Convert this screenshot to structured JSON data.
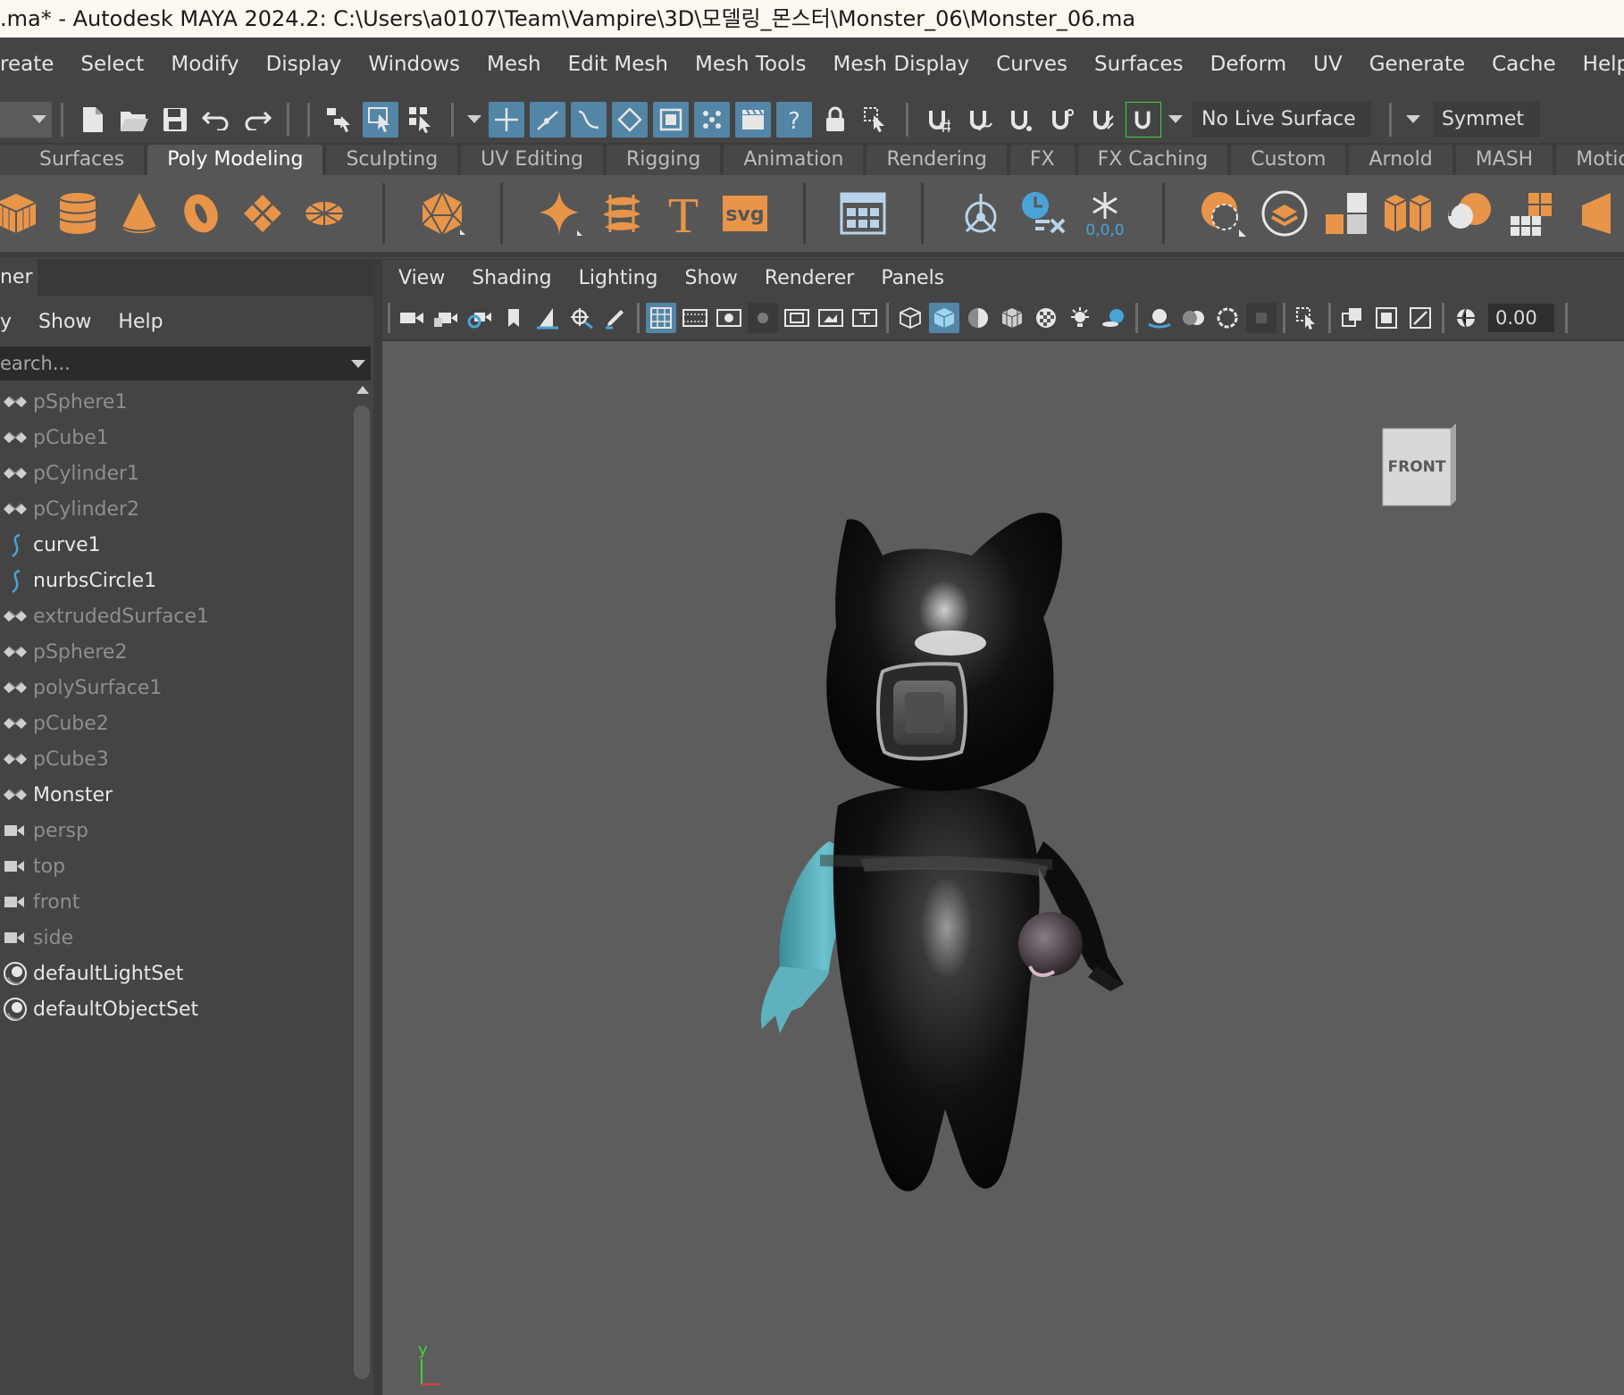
{
  "window": {
    "title": ".ma* - Autodesk MAYA 2024.2: C:\\Users\\a0107\\Team\\Vampire\\3D\\모델링_몬스터\\Monster_06\\Monster_06.ma"
  },
  "menubar": [
    "reate",
    "Select",
    "Modify",
    "Display",
    "Windows",
    "Mesh",
    "Edit Mesh",
    "Mesh Tools",
    "Mesh Display",
    "Curves",
    "Surfaces",
    "Deform",
    "UV",
    "Generate",
    "Cache",
    "Help"
  ],
  "statusline": {
    "live_surface": "No Live Surface",
    "symmetry": "Symmet"
  },
  "shelf_tabs": [
    "Surfaces",
    "Poly Modeling",
    "Sculpting",
    "UV Editing",
    "Rigging",
    "Animation",
    "Rendering",
    "FX",
    "FX Caching",
    "Custom",
    "Arnold",
    "MASH",
    "Motion Graphics"
  ],
  "shelf_active": "Poly Modeling",
  "shelf_icons": {
    "svg_label": "svg",
    "text_label": "T",
    "snapshot_label": "0,0,0"
  },
  "outliner": {
    "title": "ner",
    "menu": [
      "y",
      "Show",
      "Help"
    ],
    "search_placeholder": "earch...",
    "items": [
      {
        "label": "pSphere1",
        "icon": "mesh-icon",
        "dim": true
      },
      {
        "label": "pCube1",
        "icon": "mesh-icon",
        "dim": true
      },
      {
        "label": "pCylinder1",
        "icon": "mesh-icon",
        "dim": true
      },
      {
        "label": "pCylinder2",
        "icon": "mesh-icon",
        "dim": true
      },
      {
        "label": "curve1",
        "icon": "curve-icon",
        "dim": false
      },
      {
        "label": "nurbsCircle1",
        "icon": "curve-icon",
        "dim": false
      },
      {
        "label": "extrudedSurface1",
        "icon": "mesh-icon",
        "dim": true
      },
      {
        "label": "pSphere2",
        "icon": "mesh-icon",
        "dim": true
      },
      {
        "label": "polySurface1",
        "icon": "mesh-icon",
        "dim": true
      },
      {
        "label": "pCube2",
        "icon": "mesh-icon",
        "dim": true
      },
      {
        "label": "pCube3",
        "icon": "mesh-icon",
        "dim": true
      },
      {
        "label": "Monster",
        "icon": "mesh-icon",
        "dim": false
      },
      {
        "label": "persp",
        "icon": "camera-icon",
        "dim": true
      },
      {
        "label": "top",
        "icon": "camera-icon",
        "dim": true
      },
      {
        "label": "front",
        "icon": "camera-icon",
        "dim": true
      },
      {
        "label": "side",
        "icon": "camera-icon",
        "dim": true
      },
      {
        "label": "defaultLightSet",
        "icon": "set-icon",
        "dim": false
      },
      {
        "label": "defaultObjectSet",
        "icon": "set-icon",
        "dim": false
      }
    ]
  },
  "viewport": {
    "panel_menu": [
      "View",
      "Shading",
      "Lighting",
      "Show",
      "Renderer",
      "Panels"
    ],
    "exposure_value": "0.00",
    "view_cube_label": "FRONT",
    "axis_y": "y"
  },
  "colors": {
    "highlight": "#5285a6",
    "shelf_orange": "#e8954a",
    "curve_blue": "#4aa3d8",
    "arm_cyan": "#5fb2bd"
  }
}
